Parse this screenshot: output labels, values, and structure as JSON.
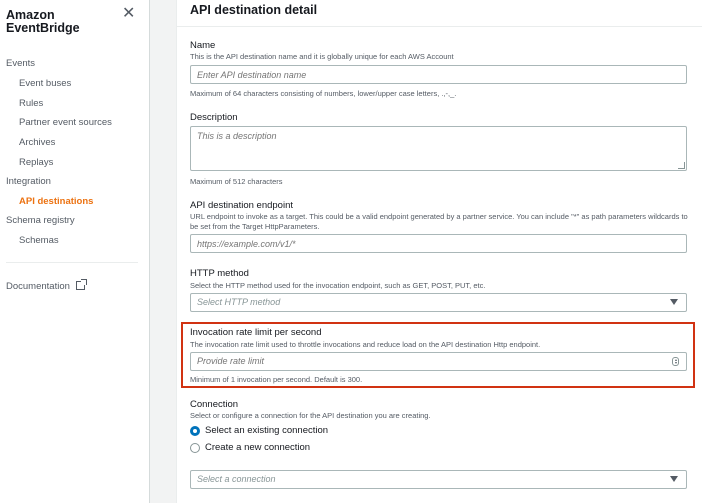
{
  "sidebar": {
    "brand_line1": "Amazon",
    "brand_line2": "EventBridge",
    "close_label": "✕",
    "events_label": "Events",
    "event_buses": "Event buses",
    "rules": "Rules",
    "partner_sources": "Partner event sources",
    "archives": "Archives",
    "replays": "Replays",
    "integration_label": "Integration",
    "api_destinations": "API destinations",
    "schema_registry": "Schema registry",
    "schemas": "Schemas",
    "documentation": "Documentation"
  },
  "panel": {
    "title": "API destination detail",
    "name": {
      "label": "Name",
      "description": "This is the API destination name and it is globally unique for each AWS Account",
      "placeholder": "Enter API destination name",
      "hint": "Maximum of 64 characters consisting of numbers, lower/upper case letters, .,-,_."
    },
    "description_field": {
      "label": "Description",
      "placeholder": "This is a description",
      "hint": "Maximum of 512 characters"
    },
    "endpoint": {
      "label": "API destination endpoint",
      "description": "URL endpoint to invoke as a target. This could be a valid endpoint generated by a partner service. You can include \"*\" as path parameters wildcards to be set from the Target HttpParameters.",
      "placeholder": "https://example.com/v1/*"
    },
    "http_method": {
      "label": "HTTP method",
      "description": "Select the HTTP method used for the invocation endpoint, such as GET, POST, PUT, etc.",
      "placeholder": "Select HTTP method"
    },
    "rate_limit": {
      "label": "Invocation rate limit per second",
      "description": "The invocation rate limit used to throttle invocations and reduce load on the API destination Http endpoint.",
      "placeholder": "Provide rate limit",
      "hint": "Minimum of 1 invocation per second. Default is 300."
    },
    "connection": {
      "label": "Connection",
      "description": "Select or configure a connection for the API destination you are creating.",
      "option_existing": "Select an existing connection",
      "option_new": "Create a new connection",
      "selected": "existing",
      "placeholder": "Select a connection"
    }
  },
  "colors": {
    "accent_orange": "#ec7211",
    "highlight_red": "#d13212",
    "radio_blue": "#0073bb"
  }
}
